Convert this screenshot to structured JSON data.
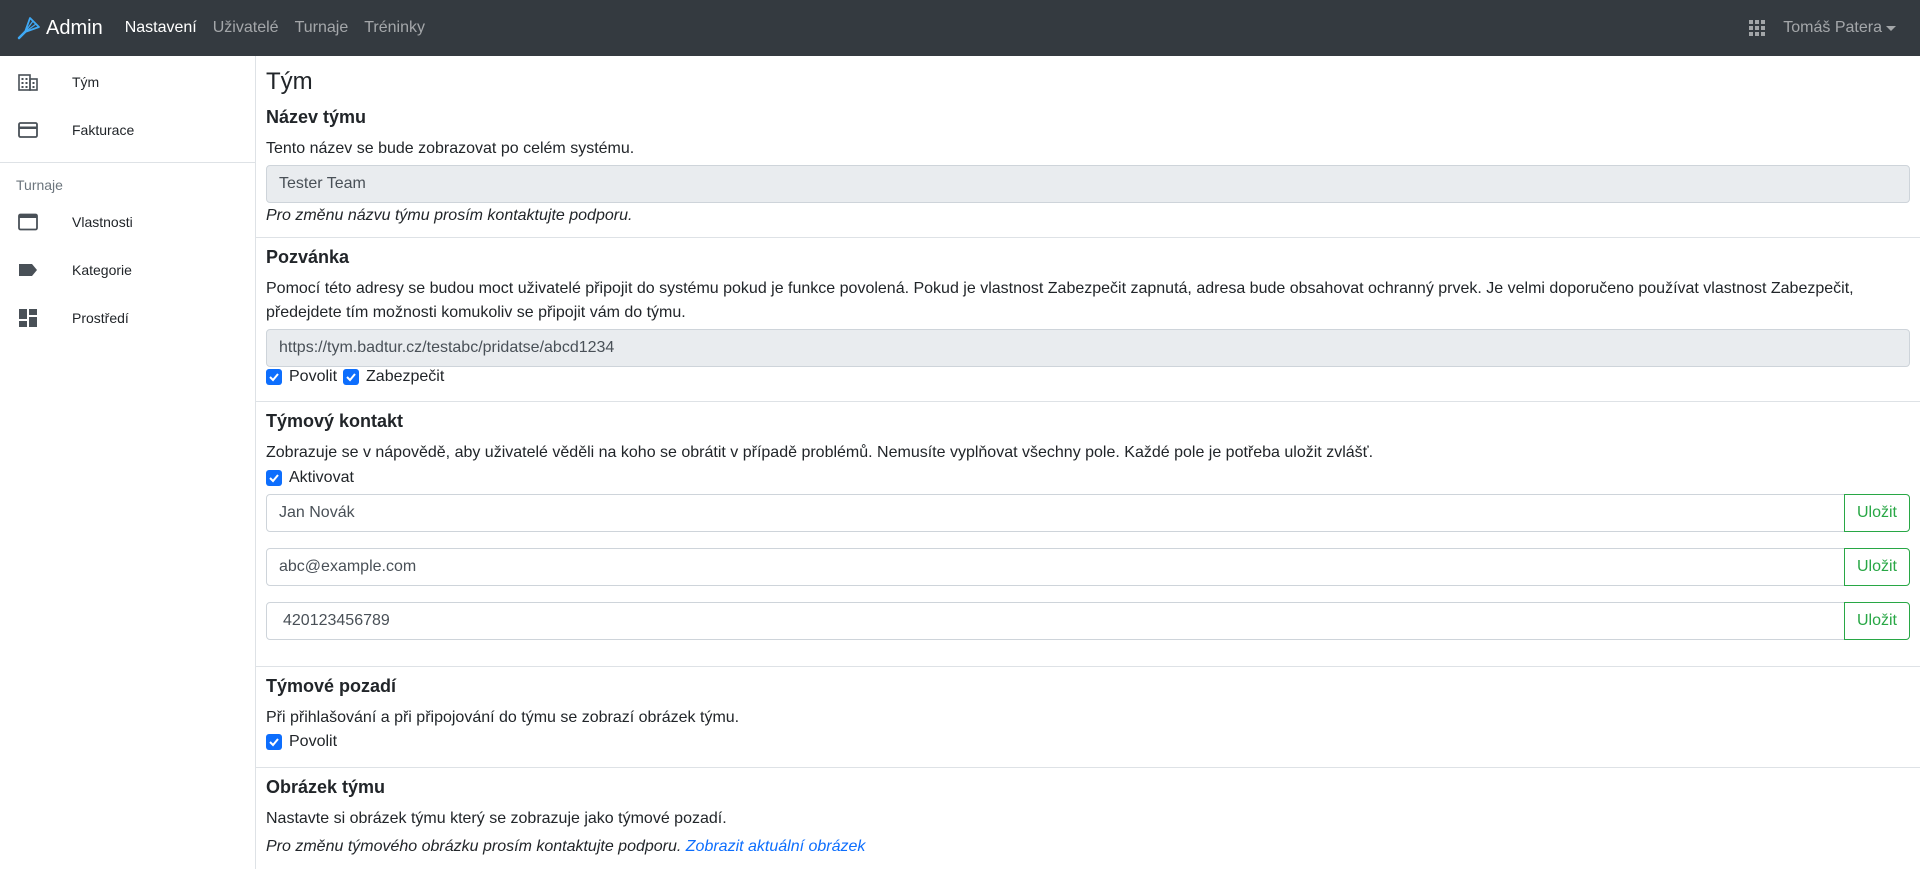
{
  "navbar": {
    "brand": "Admin",
    "items": [
      {
        "label": "Nastavení",
        "active": true
      },
      {
        "label": "Uživatelé",
        "active": false
      },
      {
        "label": "Turnaje",
        "active": false
      },
      {
        "label": "Tréninky",
        "active": false
      }
    ],
    "user_name": "Tomáš Patera",
    "apps_icon": "grid-icon"
  },
  "sidebar": {
    "items": [
      {
        "label": "Tým",
        "icon": "building-icon"
      },
      {
        "label": "Fakturace",
        "icon": "credit-card-icon"
      }
    ],
    "group_heading": "Turnaje",
    "group_items": [
      {
        "label": "Vlastnosti",
        "icon": "window-icon"
      },
      {
        "label": "Kategorie",
        "icon": "label-icon"
      },
      {
        "label": "Prostředí",
        "icon": "dashboard-icon"
      }
    ]
  },
  "page": {
    "title": "Tým",
    "team_name": {
      "heading": "Název týmu",
      "description": "Tento název se bude zobrazovat po celém systému.",
      "value": "Tester Team",
      "note": "Pro změnu názvu týmu prosím kontaktujte podporu."
    },
    "invite": {
      "heading": "Pozvánka",
      "description": "Pomocí této adresy se budou moct uživatelé připojit do systému pokud je funkce povolená. Pokud je vlastnost Zabezpečit zapnutá, adresa bude obsahovat ochranný prvek. Je velmi doporučeno používat vlastnost Zabezpečit, předejdete tím možnosti komukoliv se připojit vám do týmu.",
      "url": "https://tym.badtur.cz/testabc/pridatse/abcd1234",
      "enable_label": "Povolit",
      "enable_checked": true,
      "secure_label": "Zabezpečit",
      "secure_checked": true
    },
    "contact": {
      "heading": "Týmový kontakt",
      "description": "Zobrazuje se v nápovědě, aby uživatelé věděli na koho se obrátit v případě problémů. Nemusíte vyplňovat všechny pole. Každé pole je potřeba uložit zvlášť.",
      "activate_label": "Aktivovat",
      "activate_checked": true,
      "name_value": "Jan Novák",
      "email_value": "abc@example.com",
      "phone_value": "420123456789",
      "save_label": "Uložit"
    },
    "background": {
      "heading": "Týmové pozadí",
      "description": "Při přihlašování a při připojování do týmu se zobrazí obrázek týmu.",
      "enable_label": "Povolit",
      "enable_checked": true
    },
    "image": {
      "heading": "Obrázek týmu",
      "description": "Nastavte si obrázek týmu který se zobrazuje jako týmové pozadí.",
      "note": "Pro změnu týmového obrázku prosím kontaktujte podporu.",
      "link_label": "Zobrazit aktuální obrázek"
    }
  },
  "colors": {
    "navbar_bg": "#343a40",
    "accent_blue": "#0d6efd",
    "save_green": "#28a745"
  }
}
